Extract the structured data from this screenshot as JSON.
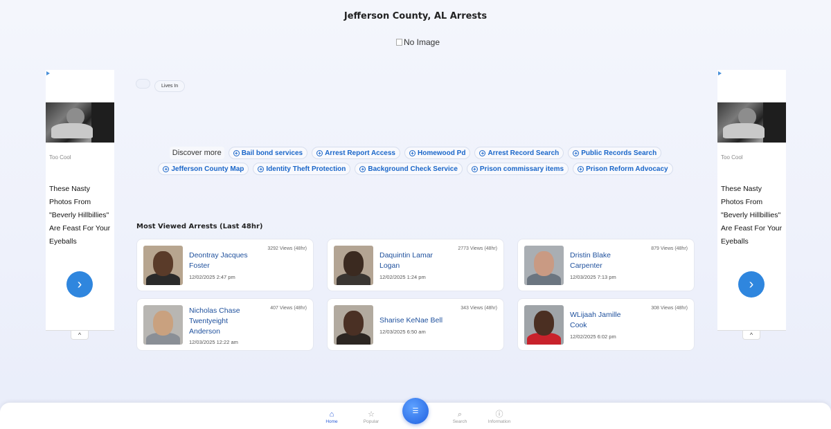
{
  "header": {
    "title": "Jefferson County, AL Arrests",
    "no_image_alt": "No Image"
  },
  "filters": {
    "lives_in": "Lives In"
  },
  "ads": [
    {
      "source": "Too Cool",
      "headline": "These Nasty Photos From \"Beverly Hillbillies\" Are Feast For Your Eyeballs",
      "arrow": "›",
      "collapse": "^"
    },
    {
      "source": "Too Cool",
      "headline": "These Nasty Photos From \"Beverly Hillbillies\" Are Feast For Your Eyeballs",
      "arrow": "›",
      "collapse": "^"
    }
  ],
  "discover": {
    "label": "Discover more",
    "row1": [
      "Bail bond services",
      "Arrest Report Access",
      "Homewood Pd",
      "Arrest Record Search",
      "Public Records Search"
    ],
    "row2": [
      "Jefferson County Map",
      "Identity Theft Protection",
      "Background Check Service",
      "Prison commissary items",
      "Prison Reform Advocacy"
    ]
  },
  "most_viewed": {
    "title": "Most Viewed Arrests (Last 48hr)",
    "cards": [
      {
        "name": "Deontray Jacques Foster",
        "date": "12/02/2025 2:47 pm",
        "views": "3292 Views (48hr)"
      },
      {
        "name": "Daquintin Lamar Logan",
        "date": "12/02/2025 1:24 pm",
        "views": "2773 Views (48hr)"
      },
      {
        "name": "Dristin Blake Carpenter",
        "date": "12/03/2025 7:13 pm",
        "views": "879 Views (48hr)"
      },
      {
        "name": "Nicholas Chase Twentyeight Anderson",
        "date": "12/03/2025 12:22 am",
        "views": "407 Views (48hr)"
      },
      {
        "name": "Sharise KeNae Bell",
        "date": "12/03/2025 6:50 am",
        "views": "343 Views (48hr)"
      },
      {
        "name": "WLijaah Jamille Cook",
        "date": "12/02/2025 6:02 pm",
        "views": "308 Views (48hr)"
      }
    ]
  },
  "nav": {
    "home": "Home",
    "popular": "Popular",
    "search": "Search",
    "information": "Information",
    "fab_icon": "filter-icon"
  },
  "colors": {
    "accent": "#2a5bd7",
    "link": "#1a66c9",
    "ad_button": "#2f86de"
  }
}
